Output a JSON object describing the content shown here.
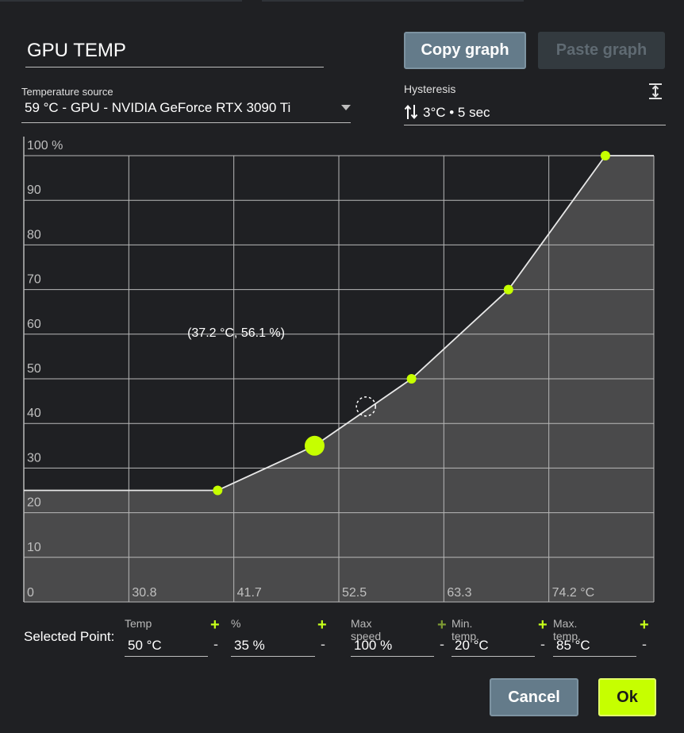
{
  "profile": {
    "name": "GPU TEMP"
  },
  "actions": {
    "copy_graph": "Copy graph",
    "paste_graph": "Paste graph",
    "cancel": "Cancel",
    "ok": "Ok"
  },
  "temperature_source": {
    "label": "Temperature source",
    "value": "59 °C - GPU - NVIDIA GeForce RTX 3090 Ti"
  },
  "hysteresis": {
    "label": "Hysteresis",
    "value": "3°C • 5 sec"
  },
  "icons": {
    "hysteresis": "up-down-arrows-icon",
    "expand": "expand-vertical-icon",
    "dropdown": "dropdown-caret-icon"
  },
  "colors": {
    "accent": "#c6ff00",
    "primary_button": "#647b8a",
    "background": "#1f2023",
    "curve_fill": "#4a4a4b"
  },
  "chart_data": {
    "type": "area",
    "x_ticks": [
      "0",
      "30.8",
      "41.7",
      "52.5",
      "63.3",
      "74.2 °C"
    ],
    "y_ticks": [
      "100 %",
      "90",
      "80",
      "70",
      "60",
      "50",
      "40",
      "30",
      "20",
      "10"
    ],
    "xlim": [
      20,
      85
    ],
    "ylim": [
      0,
      100
    ],
    "grid": true,
    "flat_start": {
      "x": 20,
      "y": 25
    },
    "points": [
      {
        "x": 40,
        "y": 25
      },
      {
        "x": 50,
        "y": 35,
        "selected": true
      },
      {
        "x": 60,
        "y": 50
      },
      {
        "x": 70,
        "y": 70
      },
      {
        "x": 80,
        "y": 100
      }
    ],
    "hover_point": {
      "x": 55.3,
      "y": 43.8
    },
    "cursor_label": "(37.2 °C, 56.1 %)",
    "cursor_label_at": {
      "x": 41.9,
      "y": 59.4
    }
  },
  "selected_point": {
    "label": "Selected Point:",
    "fields": [
      {
        "label": "Temp",
        "value": "50 °C"
      },
      {
        "label": "%",
        "value": "35 %"
      },
      {
        "label": "Max speed",
        "value": "100 %"
      },
      {
        "label": "Min. temp.",
        "value": "20 °C"
      },
      {
        "label": "Max. temp.",
        "value": "85 °C"
      }
    ],
    "plus": "+",
    "minus": "-"
  }
}
